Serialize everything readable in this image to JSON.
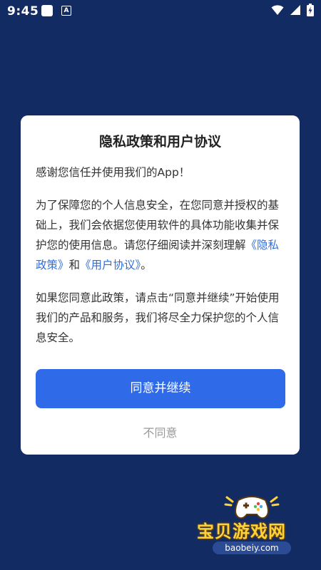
{
  "status_bar": {
    "time": "9:45",
    "notification_letter": "A",
    "icons": [
      "notification-square-icon",
      "a-notification-icon",
      "wifi-icon",
      "cellular-signal-icon",
      "battery-charging-icon"
    ]
  },
  "dialog": {
    "title": "隐私政策和用户协议",
    "intro": "感谢您信任并使用我们的App！",
    "para2_before": " 为了保障您的个人信息安全，在您同意并授权的基础上，我们会依据您使用软件的具体功能收集并保护您的使用信息。请您仔细阅读并深刻理解",
    "privacy_link": "《隐私政策》",
    "para2_and": "和",
    "agreement_link": "《用户协议》",
    "para2_end": "。",
    "para3": " 如果您同意此政策，请点击“同意并继续”开始使用我们的产品和服务，我们将尽全力保护您的个人信息安全。",
    "agree_label": "同意并继续",
    "disagree_label": "不同意"
  },
  "watermark": {
    "title": "宝贝游戏网",
    "url": "baobeiy.com"
  },
  "colors": {
    "background": "#132b63",
    "primary_button": "#2f6be9",
    "link": "#2f6fdc",
    "watermark_text": "#ffd23a"
  }
}
